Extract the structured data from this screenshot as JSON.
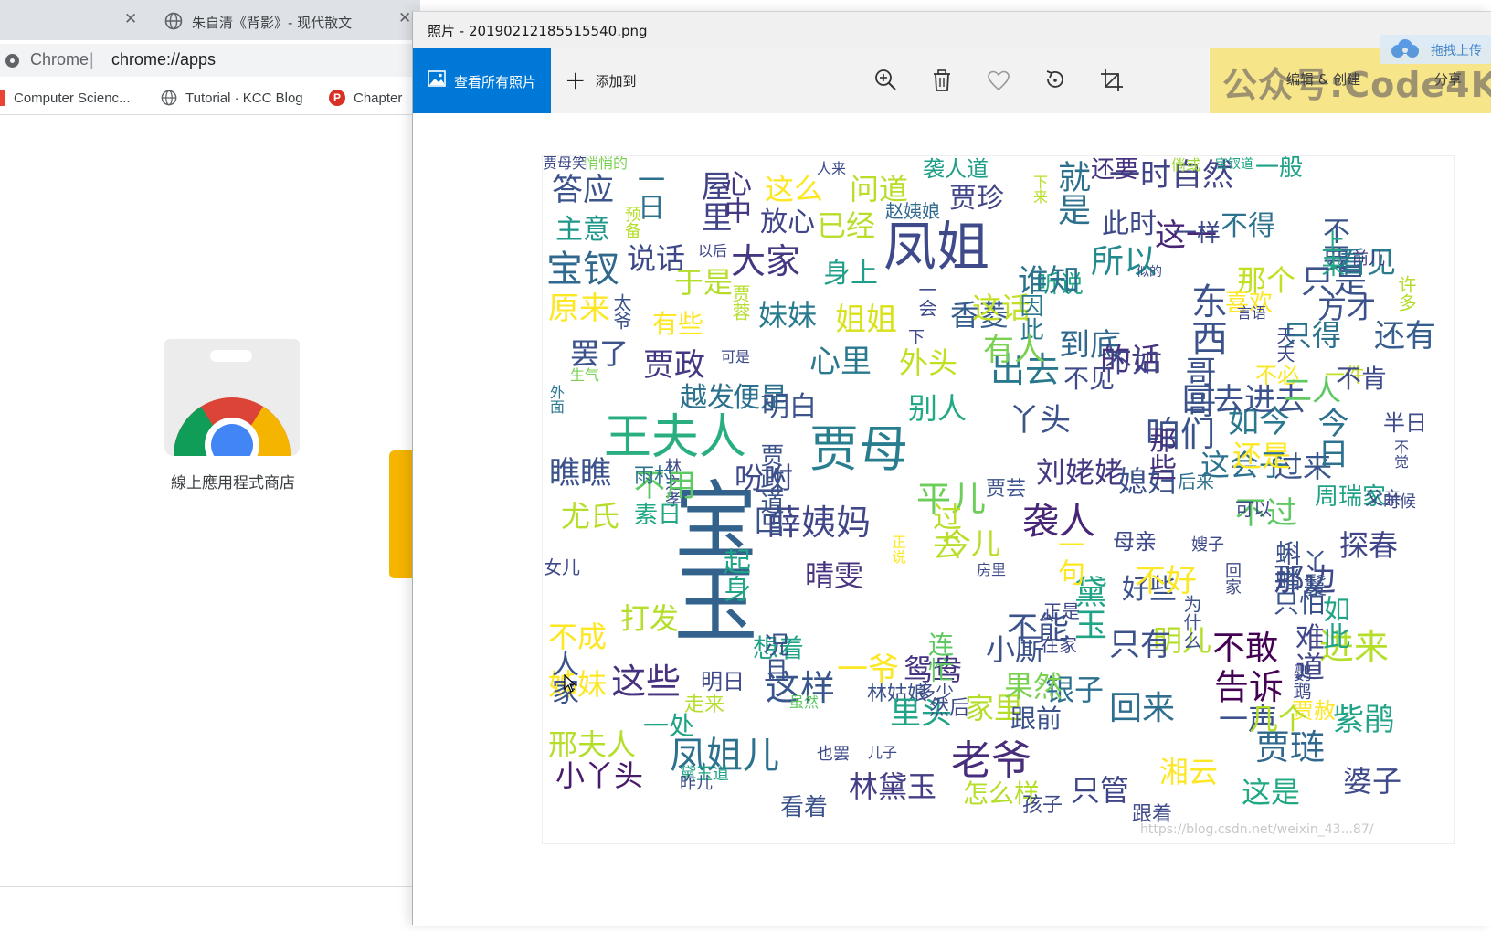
{
  "browser": {
    "tab_close": "✕",
    "tab2": {
      "title": "朱自清《背影》- 现代散文",
      "close": "✕"
    },
    "omnibox": {
      "site": "Chrome",
      "separator": "|",
      "url": "chrome://apps"
    },
    "bookmarks": [
      {
        "label": "Computer Scienc..."
      },
      {
        "label": "Tutorial · KCC Blog"
      },
      {
        "label": "Chapter"
      }
    ],
    "apps": {
      "store_label": "線上應用程式商店"
    }
  },
  "photos": {
    "title": "照片 - 20190212185515540.png",
    "toolbar": {
      "view_all": "查看所有照片",
      "add_to_plus": "+",
      "add_to": "添加到",
      "edit": "编辑 & 创建",
      "share": "分享"
    },
    "watermark": "公众号:Code4Kid",
    "upload": "拖拽上传",
    "csdn_watermark": "https://blog.csdn.net/weixin_43...87/",
    "colors": {
      "accent": "#0078d7",
      "toolbar_bg": "#f2f2f2",
      "watermark_bg": "#f7e27b"
    }
  },
  "wordcloud": {
    "colormap": "viridis",
    "words": [
      {
        "t": "宝玉",
        "s": 92,
        "c": "#33638d",
        "v": 1
      },
      {
        "t": "凤姐",
        "s": 58,
        "c": "#3e4a89",
        "v": 0
      },
      {
        "t": "贾母",
        "s": 54,
        "c": "#287d8e",
        "v": 0
      },
      {
        "t": "王夫人",
        "s": 52,
        "c": "#29af7f",
        "v": 0
      },
      {
        "t": "老爷",
        "s": 44,
        "c": "#472d7b",
        "v": 0
      },
      {
        "t": "凤姐儿",
        "s": 40,
        "c": "#2c728e",
        "v": 0
      },
      {
        "t": "东西",
        "s": 40,
        "c": "#3b528b",
        "v": 1
      },
      {
        "t": "袭人",
        "s": 40,
        "c": "#482677",
        "v": 0
      },
      {
        "t": "宝钗",
        "s": 40,
        "c": "#31688e",
        "v": 0
      },
      {
        "t": "薛姨妈",
        "s": 38,
        "c": "#404688",
        "v": 0
      },
      {
        "t": "平儿",
        "s": 38,
        "c": "#6ccd5a",
        "v": 0
      },
      {
        "t": "大家",
        "s": 38,
        "c": "#453781",
        "v": 0
      },
      {
        "t": "这样",
        "s": 38,
        "c": "#39568c",
        "v": 0
      },
      {
        "t": "告诉",
        "s": 38,
        "c": "#440154",
        "v": 0
      },
      {
        "t": "咱们",
        "s": 38,
        "c": "#3b528b",
        "v": 0
      },
      {
        "t": "进来",
        "s": 38,
        "c": "#b5de2b",
        "v": 0
      },
      {
        "t": "出去",
        "s": 38,
        "c": "#2a788e",
        "v": 0
      },
      {
        "t": "这些",
        "s": 38,
        "c": "#46327e",
        "v": 0
      },
      {
        "t": "贾琏",
        "s": 38,
        "c": "#31688e",
        "v": 0
      },
      {
        "t": "就是",
        "s": 36,
        "c": "#2d708e",
        "v": 1
      },
      {
        "t": "所以",
        "s": 36,
        "c": "#238a8d",
        "v": 0
      },
      {
        "t": "黛玉",
        "s": 36,
        "c": "#20a386",
        "v": 1
      },
      {
        "t": "回来",
        "s": 36,
        "c": "#2e6e8e",
        "v": 0
      },
      {
        "t": "只是",
        "s": 36,
        "c": "#3b528b",
        "v": 0
      },
      {
        "t": "不敢",
        "s": 36,
        "c": "#440154",
        "v": 0
      },
      {
        "t": "那边",
        "s": 34,
        "c": "#3e4989",
        "v": 0
      },
      {
        "t": "一时自然",
        "s": 34,
        "c": "#414487",
        "v": 0
      },
      {
        "t": "这一",
        "s": 34,
        "c": "#482677",
        "v": 0
      },
      {
        "t": "丫头",
        "s": 34,
        "c": "#3b528b",
        "v": 0
      },
      {
        "t": "不过",
        "s": 34,
        "c": "#5ec962",
        "v": 0
      },
      {
        "t": "如今",
        "s": 34,
        "c": "#2a788e",
        "v": 0
      },
      {
        "t": "姐姐",
        "s": 34,
        "c": "#d8e219",
        "v": 0
      },
      {
        "t": "妹妹",
        "s": 32,
        "c": "#297b8e",
        "v": 0
      },
      {
        "t": "香菱",
        "s": 32,
        "c": "#365d8d",
        "v": 0
      },
      {
        "t": "说话",
        "s": 32,
        "c": "#3e4989",
        "v": 0
      },
      {
        "t": "这么",
        "s": 32,
        "c": "#fde725",
        "v": 0
      },
      {
        "t": "问道",
        "s": 32,
        "c": "#b8de29",
        "v": 0
      },
      {
        "t": "探春",
        "s": 32,
        "c": "#404688",
        "v": 0
      },
      {
        "t": "过来",
        "s": 32,
        "c": "#3a548c",
        "v": 0
      },
      {
        "t": "刘姥姥",
        "s": 32,
        "c": "#453882",
        "v": 0
      },
      {
        "t": "媳妇",
        "s": 32,
        "c": "#3b518b",
        "v": 0
      },
      {
        "t": "这会子",
        "s": 32,
        "c": "#2c718e",
        "v": 0
      },
      {
        "t": "晴雯",
        "s": 32,
        "c": "#46327e",
        "v": 0
      },
      {
        "t": "鸳鸯",
        "s": 32,
        "c": "#46337f",
        "v": 0
      },
      {
        "t": "小厮",
        "s": 32,
        "c": "#3b528b",
        "v": 0
      },
      {
        "t": "银子",
        "s": 32,
        "c": "#2d708e",
        "v": 0
      },
      {
        "t": "林黛玉",
        "s": 32,
        "c": "#433e85",
        "v": 0
      },
      {
        "t": "只管",
        "s": 32,
        "c": "#3f4788",
        "v": 0
      },
      {
        "t": "湘云",
        "s": 32,
        "c": "#fde725",
        "v": 0
      },
      {
        "t": "婆子",
        "s": 32,
        "c": "#3e4a89",
        "v": 0
      },
      {
        "t": "这是",
        "s": 32,
        "c": "#22a884",
        "v": 0
      },
      {
        "t": "小丫头",
        "s": 32,
        "c": "#481a6c",
        "v": 0
      },
      {
        "t": "邢夫人",
        "s": 32,
        "c": "#b5de2b",
        "v": 0
      },
      {
        "t": "姊妹",
        "s": 32,
        "c": "#fde725",
        "v": 0
      },
      {
        "t": "宝钗道",
        "s": 14,
        "c": "#20a386",
        "v": 0
      },
      {
        "t": "倘或",
        "s": 16,
        "c": "#a0da39",
        "v": 0
      },
      {
        "t": "悄悄的",
        "s": 16,
        "c": "#7ad151",
        "v": 0
      },
      {
        "t": "人来",
        "s": 16,
        "c": "#3e4a89",
        "v": 0
      },
      {
        "t": "袭人道",
        "s": 24,
        "c": "#1f9f88",
        "v": 0
      },
      {
        "t": "还要",
        "s": 26,
        "c": "#46337f",
        "v": 0
      },
      {
        "t": "答应",
        "s": 34,
        "c": "#3b528b",
        "v": 0
      },
      {
        "t": "一日",
        "s": 30,
        "c": "#2c728e",
        "v": 1
      },
      {
        "t": "屋里",
        "s": 34,
        "c": "#414487",
        "v": 1
      },
      {
        "t": "心中",
        "s": 30,
        "c": "#453781",
        "v": 1
      },
      {
        "t": "主意",
        "s": 30,
        "c": "#1f988b",
        "v": 0
      },
      {
        "t": "预备",
        "s": 18,
        "c": "#b5de2b",
        "v": 1
      },
      {
        "t": "放心",
        "s": 30,
        "c": "#404688",
        "v": 0
      },
      {
        "t": "已经",
        "s": 32,
        "c": "#b8de29",
        "v": 0
      },
      {
        "t": "赵姨娘",
        "s": 20,
        "c": "#31688e",
        "v": 0
      },
      {
        "t": "贾珍",
        "s": 30,
        "c": "#404688",
        "v": 0
      },
      {
        "t": "下来",
        "s": 16,
        "c": "#b8de29",
        "v": 1
      },
      {
        "t": "听说",
        "s": 26,
        "c": "#22a884",
        "v": 0
      },
      {
        "t": "此时",
        "s": 30,
        "c": "#3e4a89",
        "v": 0
      },
      {
        "t": "一样",
        "s": 26,
        "c": "#3e4989",
        "v": 0
      },
      {
        "t": "不得",
        "s": 30,
        "c": "#2c728e",
        "v": 0
      },
      {
        "t": "一般",
        "s": 26,
        "c": "#1fa187",
        "v": 0
      },
      {
        "t": "不要",
        "s": 30,
        "c": "#3b528b",
        "v": 1
      },
      {
        "t": "上来",
        "s": 26,
        "c": "#22a884",
        "v": 1
      },
      {
        "t": "看见",
        "s": 32,
        "c": "#297b8e",
        "v": 0
      },
      {
        "t": "以后",
        "s": 16,
        "c": "#3e4a89",
        "v": 0
      },
      {
        "t": "身上",
        "s": 30,
        "c": "#1f9e89",
        "v": 0
      },
      {
        "t": "于是",
        "s": 32,
        "c": "#b5de2b",
        "v": 0
      },
      {
        "t": "谁知",
        "s": 34,
        "c": "#2c728e",
        "v": 0
      },
      {
        "t": "那个",
        "s": 32,
        "c": "#c2df23",
        "v": 0
      },
      {
        "t": "前儿",
        "s": 18,
        "c": "#453781",
        "v": 0
      },
      {
        "t": "许多",
        "s": 20,
        "c": "#b5de2b",
        "v": 1
      },
      {
        "t": "原来",
        "s": 34,
        "c": "#fde725",
        "v": 0
      },
      {
        "t": "太爷",
        "s": 20,
        "c": "#3b528b",
        "v": 1
      },
      {
        "t": "贾蓉",
        "s": 20,
        "c": "#b5de2b",
        "v": 1
      },
      {
        "t": "一会",
        "s": 20,
        "c": "#3e4a89",
        "v": 1
      },
      {
        "t": "这话",
        "s": 32,
        "c": "#c2df23",
        "v": 0
      },
      {
        "t": "喜欢",
        "s": 26,
        "c": "#fde725",
        "v": 0
      },
      {
        "t": "方才",
        "s": 32,
        "c": "#3b528b",
        "v": 0
      },
      {
        "t": "只得",
        "s": 32,
        "c": "#2c718e",
        "v": 0
      },
      {
        "t": "还有",
        "s": 34,
        "c": "#365d8d",
        "v": 0
      },
      {
        "t": "天天",
        "s": 20,
        "c": "#3e4a89",
        "v": 1
      },
      {
        "t": "有些",
        "s": 28,
        "c": "#fde725",
        "v": 0
      },
      {
        "t": "因此",
        "s": 26,
        "c": "#2a788e",
        "v": 1
      },
      {
        "t": "下",
        "s": 18,
        "c": "#3e4a89",
        "v": 0
      },
      {
        "t": "似的",
        "s": 14,
        "c": "#3b528b",
        "v": 0
      },
      {
        "t": "言语",
        "s": 16,
        "c": "#3e4a89",
        "v": 0
      },
      {
        "t": "到底",
        "s": 34,
        "c": "#31688e",
        "v": 0
      },
      {
        "t": "有人",
        "s": 34,
        "c": "#7ad151",
        "v": 0
      },
      {
        "t": "罢了",
        "s": 32,
        "c": "#3b528b",
        "v": 0
      },
      {
        "t": "贾政",
        "s": 34,
        "c": "#453781",
        "v": 0
      },
      {
        "t": "可是",
        "s": 16,
        "c": "#3e4a89",
        "v": 0
      },
      {
        "t": "心里",
        "s": 34,
        "c": "#2a788e",
        "v": 0
      },
      {
        "t": "外头",
        "s": 32,
        "c": "#c2df23",
        "v": 0
      },
      {
        "t": "的话",
        "s": 34,
        "c": "#46327e",
        "v": 0
      },
      {
        "t": "哥哥",
        "s": 34,
        "c": "#3b528b",
        "v": 1
      },
      {
        "t": "不必",
        "s": 24,
        "c": "#fde725",
        "v": 0
      },
      {
        "t": "一件",
        "s": 22,
        "c": "#c2df23",
        "v": 0
      },
      {
        "t": "生气",
        "s": 16,
        "c": "#7ad151",
        "v": 0
      },
      {
        "t": "外面",
        "s": 16,
        "c": "#2a788e",
        "v": 1
      },
      {
        "t": "越发",
        "s": 30,
        "c": "#2c718e",
        "v": 0
      },
      {
        "t": "便是",
        "s": 30,
        "c": "#2c718e",
        "v": 0
      },
      {
        "t": "不见",
        "s": 28,
        "c": "#3e4a89",
        "v": 0
      },
      {
        "t": "不如",
        "s": 30,
        "c": "#404688",
        "v": 0
      },
      {
        "t": "回去进去",
        "s": 34,
        "c": "#3b528b",
        "v": 0
      },
      {
        "t": "二人",
        "s": 32,
        "c": "#5ec962",
        "v": 0
      },
      {
        "t": "不肯",
        "s": 28,
        "c": "#3e4a89",
        "v": 0
      },
      {
        "t": "明白",
        "s": 30,
        "c": "#3b528b",
        "v": 0
      },
      {
        "t": "别人",
        "s": 32,
        "c": "#22a884",
        "v": 0
      },
      {
        "t": "今日",
        "s": 34,
        "c": "#2c718e",
        "v": 1
      },
      {
        "t": "那些",
        "s": 30,
        "c": "#46327e",
        "v": 1
      },
      {
        "t": "还是",
        "s": 32,
        "c": "#fde725",
        "v": 0
      },
      {
        "t": "半日",
        "s": 24,
        "c": "#3e4a89",
        "v": 0
      },
      {
        "t": "不觉",
        "s": 16,
        "c": "#3e4a89",
        "v": 1
      },
      {
        "t": "林之孝",
        "s": 18,
        "c": "#3e4a89",
        "v": 1
      },
      {
        "t": "吩咐",
        "s": 32,
        "c": "#3e4a89",
        "v": 0
      },
      {
        "t": "瞧瞧",
        "s": 34,
        "c": "#3b528b",
        "v": 0
      },
      {
        "t": "不用",
        "s": 34,
        "c": "#5ec962",
        "v": 0
      },
      {
        "t": "贾政道",
        "s": 26,
        "c": "#3b528b",
        "v": 1
      },
      {
        "t": "贾芸",
        "s": 22,
        "c": "#3b528b",
        "v": 0
      },
      {
        "t": "后来",
        "s": 20,
        "c": "#2c718e",
        "v": 0
      },
      {
        "t": "可以",
        "s": 20,
        "c": "#3e4a89",
        "v": 0
      },
      {
        "t": "周瑞家",
        "s": 26,
        "c": "#20a386",
        "v": 0
      },
      {
        "t": "父亲",
        "s": 20,
        "c": "#3e4a89",
        "v": 0
      },
      {
        "t": "时候",
        "s": 18,
        "c": "#3e4a89",
        "v": 0
      },
      {
        "t": "尤氏",
        "s": 32,
        "c": "#b5de2b",
        "v": 0
      },
      {
        "t": "雨村",
        "s": 22,
        "c": "#2c718e",
        "v": 0
      },
      {
        "t": "女儿",
        "s": 20,
        "c": "#3e4a89",
        "v": 0
      },
      {
        "t": "素日",
        "s": 26,
        "c": "#22a884",
        "v": 0
      },
      {
        "t": "一回",
        "s": 32,
        "c": "#3b528b",
        "v": 1
      },
      {
        "t": "起身",
        "s": 30,
        "c": "#20a386",
        "v": 1
      },
      {
        "t": "正说",
        "s": 16,
        "c": "#fde725",
        "v": 1
      },
      {
        "t": "过去",
        "s": 32,
        "c": "#b8de29",
        "v": 1
      },
      {
        "t": "今儿",
        "s": 32,
        "c": "#b8de29",
        "v": 0
      },
      {
        "t": "房里",
        "s": 16,
        "c": "#3e4a89",
        "v": 0
      },
      {
        "t": "母亲",
        "s": 24,
        "c": "#3e4a89",
        "v": 0
      },
      {
        "t": "好些",
        "s": 30,
        "c": "#3b528b",
        "v": 0
      },
      {
        "t": "嫂子",
        "s": 18,
        "c": "#3e4a89",
        "v": 0
      },
      {
        "t": "只怕",
        "s": 28,
        "c": "#3b528b",
        "v": 0
      },
      {
        "t": "一句",
        "s": 30,
        "c": "#fde725",
        "v": 1
      },
      {
        "t": "不好",
        "s": 34,
        "c": "#fde725",
        "v": 0
      },
      {
        "t": "回家",
        "s": 18,
        "c": "#3e4a89",
        "v": 1
      },
      {
        "t": "蝌蟠",
        "s": 28,
        "c": "#3b528b",
        "v": 1
      },
      {
        "t": "丫鬟",
        "s": 26,
        "c": "#3b528b",
        "v": 1
      },
      {
        "t": "如此",
        "s": 30,
        "c": "#20a386",
        "v": 1
      },
      {
        "t": "难道",
        "s": 32,
        "c": "#404688",
        "v": 1
      },
      {
        "t": "鹦鹉",
        "s": 20,
        "c": "#3e4a89",
        "v": 1
      },
      {
        "t": "不成",
        "s": 32,
        "c": "#fde725",
        "v": 0
      },
      {
        "t": "打发",
        "s": 32,
        "c": "#b5de2b",
        "v": 0
      },
      {
        "t": "想着",
        "s": 28,
        "c": "#20a386",
        "v": 0
      },
      {
        "t": "一爷",
        "s": 34,
        "c": "#fde725",
        "v": 0
      },
      {
        "t": "连忙",
        "s": 28,
        "c": "#5ec962",
        "v": 1
      },
      {
        "t": "家里",
        "s": 32,
        "c": "#b5de2b",
        "v": 0
      },
      {
        "t": "不能",
        "s": 34,
        "c": "#3b528b",
        "v": 0
      },
      {
        "t": "在家",
        "s": 20,
        "c": "#3e4a89",
        "v": 0
      },
      {
        "t": "正是",
        "s": 20,
        "c": "#3e4a89",
        "v": 0
      },
      {
        "t": "人家",
        "s": 30,
        "c": "#3b528b",
        "v": 1
      },
      {
        "t": "虽然",
        "s": 16,
        "c": "#5ec962",
        "v": 0
      },
      {
        "t": "林姑娘",
        "s": 22,
        "c": "#3b528b",
        "v": 0
      },
      {
        "t": "况且",
        "s": 28,
        "c": "#3b528b",
        "v": 1
      },
      {
        "t": "明儿",
        "s": 32,
        "c": "#b5de2b",
        "v": 0
      },
      {
        "t": "为什么",
        "s": 20,
        "c": "#3b528b",
        "v": 1
      },
      {
        "t": "贾赦",
        "s": 24,
        "c": "#fde725",
        "v": 0
      },
      {
        "t": "紫鹃",
        "s": 34,
        "c": "#20a386",
        "v": 0
      },
      {
        "t": "一处",
        "s": 28,
        "c": "#20a386",
        "v": 0
      },
      {
        "t": "明日",
        "s": 24,
        "c": "#3e4a89",
        "v": 0
      },
      {
        "t": "里头",
        "s": 34,
        "c": "#20a386",
        "v": 0
      },
      {
        "t": "然后",
        "s": 22,
        "c": "#3e4a89",
        "v": 0
      },
      {
        "t": "果然",
        "s": 32,
        "c": "#7ad151",
        "v": 0
      },
      {
        "t": "跟前",
        "s": 28,
        "c": "#3b528b",
        "v": 0
      },
      {
        "t": "只有",
        "s": 34,
        "c": "#3b528b",
        "v": 0
      },
      {
        "t": "一声",
        "s": 32,
        "c": "#3b528b",
        "v": 0
      },
      {
        "t": "几个",
        "s": 32,
        "c": "#b5de2b",
        "v": 0
      },
      {
        "t": "黛玉道",
        "s": 18,
        "c": "#20a386",
        "v": 0
      },
      {
        "t": "走来",
        "s": 22,
        "c": "#b5de2b",
        "v": 0
      },
      {
        "t": "昨儿",
        "s": 18,
        "c": "#3e4a89",
        "v": 0
      },
      {
        "t": "儿子",
        "s": 16,
        "c": "#3e4a89",
        "v": 0
      },
      {
        "t": "多少",
        "s": 20,
        "c": "#3e4a89",
        "v": 0
      },
      {
        "t": "也罢",
        "s": 18,
        "c": "#3e4a89",
        "v": 0
      },
      {
        "t": "看着",
        "s": 26,
        "c": "#3b528b",
        "v": 0
      },
      {
        "t": "怎么样",
        "s": 28,
        "c": "#b5de2b",
        "v": 0
      },
      {
        "t": "孩子",
        "s": 22,
        "c": "#3e4a89",
        "v": 0
      },
      {
        "t": "跟着",
        "s": 22,
        "c": "#3e4a89",
        "v": 0
      },
      {
        "t": "贾母笑",
        "s": 16,
        "c": "#3e4a89",
        "v": 0
      }
    ]
  }
}
